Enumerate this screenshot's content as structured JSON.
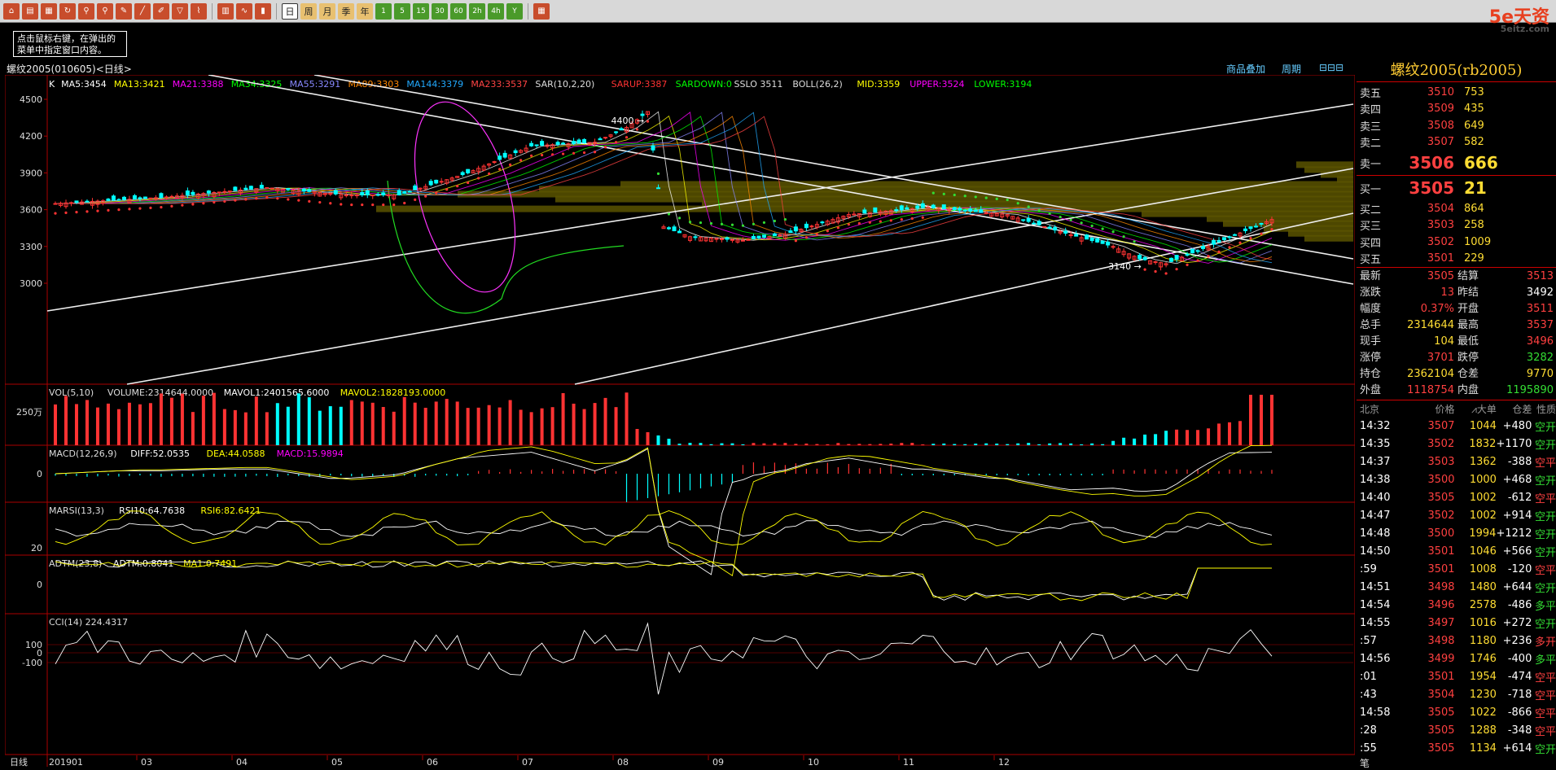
{
  "toolbar": {
    "buttons": [
      "日",
      "周",
      "月",
      "季",
      "年",
      "1",
      "5",
      "15",
      "30",
      "60",
      "2h",
      "4h",
      "Y"
    ],
    "selected": "日"
  },
  "logo": {
    "brand": "5e天资",
    "url": "5eitz.com"
  },
  "tip": "点击鼠标右键，在弹出的菜单中指定窗口内容。",
  "chart": {
    "title": "螺纹2005(010605)<日线>",
    "links": [
      "商品叠加",
      "周期"
    ],
    "main_indicators": [
      {
        "text": "K",
        "color": "#ffffff"
      },
      {
        "text": "MA5:3454",
        "color": "#ffffff"
      },
      {
        "text": "MA13:3421",
        "color": "#ffff00"
      },
      {
        "text": "MA21:3388",
        "color": "#ff00ff"
      },
      {
        "text": "MA34:3325",
        "color": "#00ff00"
      },
      {
        "text": "MA55:3291",
        "color": "#8888ff"
      },
      {
        "text": "MA89:3303",
        "color": "#ff8800"
      },
      {
        "text": "MA144:3379",
        "color": "#22aaff"
      },
      {
        "text": "MA233:3537",
        "color": "#ff4444"
      },
      {
        "text": "SAR(10,2,20)",
        "color": "#dddddd"
      },
      {
        "text": "SARUP:3387",
        "color": "#ff3333"
      },
      {
        "text": "SARDOWN:0",
        "color": "#00ff00"
      },
      {
        "text": "SSLO 3511",
        "color": "#dddddd"
      },
      {
        "text": "BOLL(26,2)",
        "color": "#dddddd"
      },
      {
        "text": "MID:3359",
        "color": "#ffff00"
      },
      {
        "text": "UPPER:3524",
        "color": "#ff00ff"
      },
      {
        "text": "LOWER:3194",
        "color": "#00ff00"
      }
    ],
    "price_ticks": [
      "4500",
      "4200",
      "3900",
      "3600",
      "3300",
      "3000"
    ],
    "annotations": {
      "high": "4400",
      "low": "3140"
    },
    "vol": {
      "header": [
        {
          "text": "VOL(5,10)",
          "color": "#dddddd"
        },
        {
          "text": "VOLUME:2314644.0000",
          "color": "#dddddd"
        },
        {
          "text": "MAVOL1:2401565.6000",
          "color": "#ffffff"
        },
        {
          "text": "MAVOL2:1828193.0000",
          "color": "#ffff00"
        }
      ],
      "tick": "250万"
    },
    "macd": {
      "header": [
        {
          "text": "MACD(12,26,9)",
          "color": "#dddddd"
        },
        {
          "text": "DIFF:52.0535",
          "color": "#ffffff"
        },
        {
          "text": "DEA:44.0588",
          "color": "#ffff00"
        },
        {
          "text": "MACD:15.9894",
          "color": "#ff00ff"
        }
      ],
      "tick": "0"
    },
    "marsi": {
      "header": [
        {
          "text": "MARSI(13,3)",
          "color": "#dddddd"
        },
        {
          "text": "RSI10:64.7638",
          "color": "#ffffff"
        },
        {
          "text": "RSI6:82.6421",
          "color": "#ffff00"
        }
      ],
      "tick": "20"
    },
    "adtm": {
      "header": [
        {
          "text": "ADTM(23,8)",
          "color": "#dddddd"
        },
        {
          "text": "ADTM:0.8041",
          "color": "#ffffff"
        },
        {
          "text": "MA1:0.7491",
          "color": "#ffff00"
        }
      ],
      "tick": "0"
    },
    "cci": {
      "header": [
        {
          "text": "CCI(14) 224.4317",
          "color": "#dddddd"
        }
      ],
      "ticks": [
        "100",
        "0",
        "-100"
      ]
    },
    "xaxis": {
      "label": "日线",
      "start": "201901",
      "months": [
        "03",
        "04",
        "05",
        "06",
        "07",
        "08",
        "09",
        "10",
        "11",
        "12"
      ]
    }
  },
  "quote": {
    "title": "螺纹2005(rb2005)",
    "asks": [
      {
        "label": "卖五",
        "price": "3510",
        "vol": "753"
      },
      {
        "label": "卖四",
        "price": "3509",
        "vol": "435"
      },
      {
        "label": "卖三",
        "price": "3508",
        "vol": "649"
      },
      {
        "label": "卖二",
        "price": "3507",
        "vol": "582"
      }
    ],
    "ask1": {
      "label": "卖一",
      "price": "3506",
      "vol": "666"
    },
    "bid1": {
      "label": "买一",
      "price": "3505",
      "vol": "21"
    },
    "bids": [
      {
        "label": "买二",
        "price": "3504",
        "vol": "864"
      },
      {
        "label": "买三",
        "price": "3503",
        "vol": "258"
      },
      {
        "label": "买四",
        "price": "3502",
        "vol": "1009"
      },
      {
        "label": "买五",
        "price": "3501",
        "vol": "229"
      }
    ],
    "info": [
      {
        "l": "最新",
        "v": "3505",
        "c": "#ff4040",
        "l2": "结算",
        "v2": "3513",
        "c2": "#ff4040"
      },
      {
        "l": "涨跌",
        "v": "13",
        "c": "#ff4040",
        "l2": "昨结",
        "v2": "3492",
        "c2": "#ffffff"
      },
      {
        "l": "幅度",
        "v": "0.37%",
        "c": "#ff4040",
        "l2": "开盘",
        "v2": "3511",
        "c2": "#ff4040"
      },
      {
        "l": "总手",
        "v": "2314644",
        "c": "#ffdd33",
        "l2": "最高",
        "v2": "3537",
        "c2": "#ff4040"
      },
      {
        "l": "现手",
        "v": "104",
        "c": "#ffdd33",
        "l2": "最低",
        "v2": "3496",
        "c2": "#ff4040"
      },
      {
        "l": "涨停",
        "v": "3701",
        "c": "#ff4040",
        "l2": "跌停",
        "v2": "3282",
        "c2": "#33dd33"
      },
      {
        "l": "持仓",
        "v": "2362104",
        "c": "#ffdd33",
        "l2": "仓差",
        "v2": "9770",
        "c2": "#ffdd33"
      },
      {
        "l": "外盘",
        "v": "1118754",
        "c": "#ff4040",
        "l2": "内盘",
        "v2": "1195890",
        "c2": "#33dd33"
      }
    ],
    "tick_header": {
      "city": "北京",
      "price": "价格",
      "vol": "⩘大单",
      "oi": "仓差",
      "type": "性质"
    },
    "ticks": [
      {
        "t": "14:32",
        "p": "3507",
        "v": "1044",
        "oi": "+480",
        "ty": "空开",
        "pc": "red",
        "tc": "green"
      },
      {
        "t": "14:35",
        "p": "3502",
        "v": "1832",
        "oi": "+1170",
        "ty": "空开",
        "pc": "red",
        "tc": "green"
      },
      {
        "t": "14:37",
        "p": "3503",
        "v": "1362",
        "oi": "-388",
        "ty": "空平",
        "pc": "red",
        "tc": "red"
      },
      {
        "t": "14:38",
        "p": "3500",
        "v": "1000",
        "oi": "+468",
        "ty": "空开",
        "pc": "red",
        "tc": "green"
      },
      {
        "t": "14:40",
        "p": "3505",
        "v": "1002",
        "oi": "-612",
        "ty": "空平",
        "pc": "red",
        "tc": "red"
      },
      {
        "t": "14:47",
        "p": "3502",
        "v": "1002",
        "oi": "+914",
        "ty": "空开",
        "pc": "red",
        "tc": "green"
      },
      {
        "t": "14:48",
        "p": "3500",
        "v": "1994",
        "oi": "+1212",
        "ty": "空开",
        "pc": "red",
        "tc": "green"
      },
      {
        "t": "14:50",
        "p": "3501",
        "v": "1046",
        "oi": "+566",
        "ty": "空开",
        "pc": "red",
        "tc": "green"
      },
      {
        "t": ":59",
        "p": "3501",
        "v": "1008",
        "oi": "-120",
        "ty": "空平",
        "pc": "red",
        "tc": "red"
      },
      {
        "t": "14:51",
        "p": "3498",
        "v": "1480",
        "oi": "+644",
        "ty": "空开",
        "pc": "red",
        "tc": "green"
      },
      {
        "t": "14:54",
        "p": "3496",
        "v": "2578",
        "oi": "-486",
        "ty": "多平",
        "pc": "red",
        "tc": "green"
      },
      {
        "t": "14:55",
        "p": "3497",
        "v": "1016",
        "oi": "+272",
        "ty": "空开",
        "pc": "red",
        "tc": "green"
      },
      {
        "t": ":57",
        "p": "3498",
        "v": "1180",
        "oi": "+236",
        "ty": "多开",
        "pc": "red",
        "tc": "red"
      },
      {
        "t": "14:56",
        "p": "3499",
        "v": "1746",
        "oi": "-400",
        "ty": "多平",
        "pc": "red",
        "tc": "green"
      },
      {
        "t": ":01",
        "p": "3501",
        "v": "1954",
        "oi": "-474",
        "ty": "空平",
        "pc": "red",
        "tc": "red"
      },
      {
        "t": ":43",
        "p": "3504",
        "v": "1230",
        "oi": "-718",
        "ty": "空平",
        "pc": "red",
        "tc": "red"
      },
      {
        "t": "14:58",
        "p": "3505",
        "v": "1022",
        "oi": "-866",
        "ty": "空平",
        "pc": "red",
        "tc": "red"
      },
      {
        "t": ":28",
        "p": "3505",
        "v": "1288",
        "oi": "-348",
        "ty": "空平",
        "pc": "red",
        "tc": "red"
      },
      {
        "t": ":55",
        "p": "3505",
        "v": "1134",
        "oi": "+614",
        "ty": "空开",
        "pc": "red",
        "tc": "green"
      }
    ],
    "footer": "笔"
  }
}
